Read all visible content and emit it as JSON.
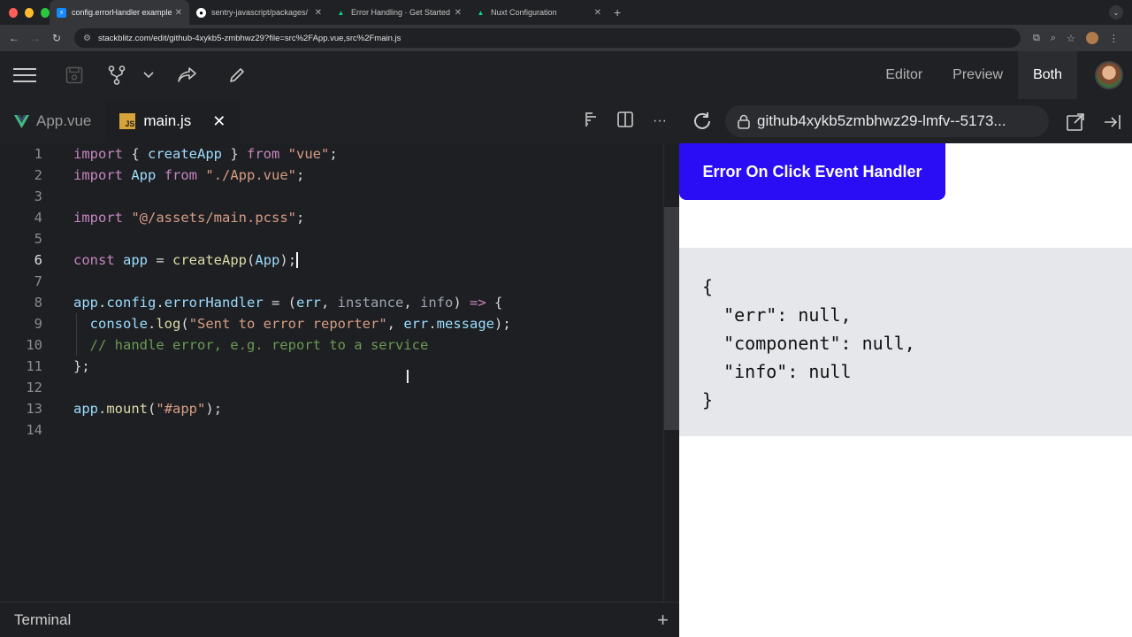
{
  "browser": {
    "tabs": [
      {
        "title": "config.errorHandler example",
        "active": true
      },
      {
        "title": "sentry-javascript/packages/"
      },
      {
        "title": "Error Handling · Get Started"
      },
      {
        "title": "Nuxt Configuration"
      }
    ],
    "url": "stackblitz.com/edit/github-4xykb5-zmbhwz29?file=src%2FApp.vue,src%2Fmain.js"
  },
  "toolbar": {
    "views": [
      "Editor",
      "Preview",
      "Both"
    ],
    "active_view": "Both"
  },
  "editor": {
    "tabs": [
      {
        "label": "App.vue",
        "active": false
      },
      {
        "label": "main.js",
        "active": true
      }
    ],
    "line_numbers": [
      "1",
      "2",
      "3",
      "4",
      "5",
      "6",
      "7",
      "8",
      "9",
      "10",
      "11",
      "12",
      "13",
      "14"
    ],
    "current_line": "6"
  },
  "preview": {
    "url": "github4xykb5zmbhwz29-lmfv--5173...",
    "button_label": "Error On Click Event Handler",
    "json_output": "{\n  \"err\": null,\n  \"component\": null,\n  \"info\": null\n}"
  },
  "terminal": {
    "label": "Terminal"
  }
}
